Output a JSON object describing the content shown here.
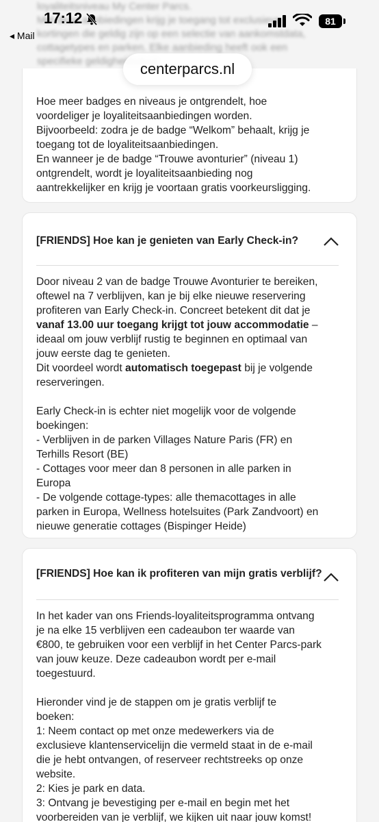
{
  "status": {
    "time": "17:12",
    "back_label": "Mail",
    "battery": "81"
  },
  "browser": {
    "url": "centerparcs.nl"
  },
  "blurred_top": [
    "loyaliteitsniveau My Center Parcs.",
    "Met deze aanbiedingen krijg je toegang tot exclusieve",
    "kortingen die geldig zijn op een selectie van aankomstdata,",
    "cottagetypes en parken. Elke aanbieding heeft ook een",
    "specifieke geldigheidsduur."
  ],
  "card1": {
    "lines": [
      "Hoe meer badges en niveaus je ontgrendelt, hoe",
      "voordeliger je loyaliteitsaanbiedingen worden.",
      "Bijvoorbeeld: zodra je de badge “Welkom” behaalt, krijg je",
      "toegang tot de loyaliteitsaanbiedingen.",
      "En wanneer je de badge “Trouwe avonturier” (niveau 1)",
      "ontgrendelt, wordt je loyaliteitsaanbieding nog",
      "aantrekkelijker en krijg je voortaan gratis voorkeursligging."
    ]
  },
  "card2": {
    "title": "[FRIENDS] Hoe kan je genieten van Early Check-in?",
    "l1": "Door niveau 2 van de badge Trouwe Avonturier te bereiken,",
    "l2": "oftewel na 7 verblijven, kan je bij elke nieuwe reservering",
    "l3": "profiteren van Early Check-in. Concreet betekent dit dat je",
    "l4_bold": "vanaf 13.00 uur toegang krijgt tot jouw accommodatie",
    "l4_rest": " –",
    "l5": "ideaal om jouw verblijf rustig te beginnen en optimaal van",
    "l6": "jouw eerste dag te genieten.",
    "l7_pre": "Dit voordeel wordt ",
    "l7_bold": "automatisch toegepast",
    "l7_post": " bij je volgende",
    "l8": "reserveringen.",
    "lines2": [
      "Early Check-in is echter niet mogelijk voor de volgende",
      "boekingen:",
      "- Verblijven in de parken Villages Nature Paris (FR) en",
      "Terhills Resort (BE)",
      "- Cottages voor meer dan 8 personen in alle parken in",
      "Europa",
      "- De volgende cottage-types: alle themacottages in alle",
      "parken in Europa, Wellness hotelsuites (Park Zandvoort) en",
      "nieuwe generatie cottages (Bispinger Heide)"
    ]
  },
  "card3": {
    "title": "[FRIENDS] Hoe kan ik profiteren van mijn gratis verblijf?",
    "lines1": [
      "In het kader van ons Friends-loyaliteitsprogramma ontvang",
      "je na elke 15 verblijven een cadeaubon ter waarde van",
      "€800, te gebruiken voor een verblijf in het Center Parcs-park",
      "van jouw keuze.  Deze cadeaubon wordt per e-mail",
      "toegestuurd."
    ],
    "lines2": [
      "Hieronder vind je de stappen om je gratis verblijf te",
      "boeken:",
      "1: Neem contact op met onze medewerkers via de",
      "exclusieve klantenservicelijn die vermeld staat in de e-mail",
      "die je hebt ontvangen, of reserveer rechtstreeks op onze",
      "website.",
      "2: Kies je park en data.",
      "3: Ontvang je bevestiging per e-mail en begin met het",
      "voorbereiden van je verblijf, we kijken uit naar jouw komst!"
    ]
  }
}
